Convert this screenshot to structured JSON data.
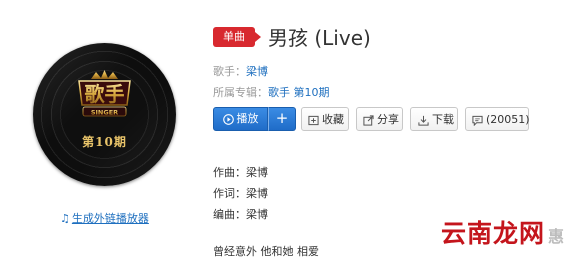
{
  "album": {
    "logo_text": "歌手",
    "logo_sub": "SINGER",
    "episode": "第10期"
  },
  "player_link": {
    "icon": "music-note-icon",
    "label": "生成外链播放器"
  },
  "badge": {
    "label": "单曲"
  },
  "song": {
    "title": "男孩 (Live)"
  },
  "meta": {
    "singer_key": "歌手：",
    "singer": "梁博",
    "album_key": "所属专辑：",
    "album": "歌手 第10期"
  },
  "actions": {
    "play": "播放",
    "add": "+",
    "collect": "收藏",
    "share": "分享",
    "download": "下载",
    "comments": "(20051)"
  },
  "lyrics": [
    "作曲：梁博",
    "作词：梁博",
    "编曲：梁博",
    "曾经意外 他和她 相爱"
  ],
  "watermark": {
    "text": "云南龙网",
    "mark": "惠"
  },
  "colors": {
    "brand_red": "#d8292f",
    "link_blue": "#1e6fbf",
    "play_blue": "#2a7ad6"
  }
}
